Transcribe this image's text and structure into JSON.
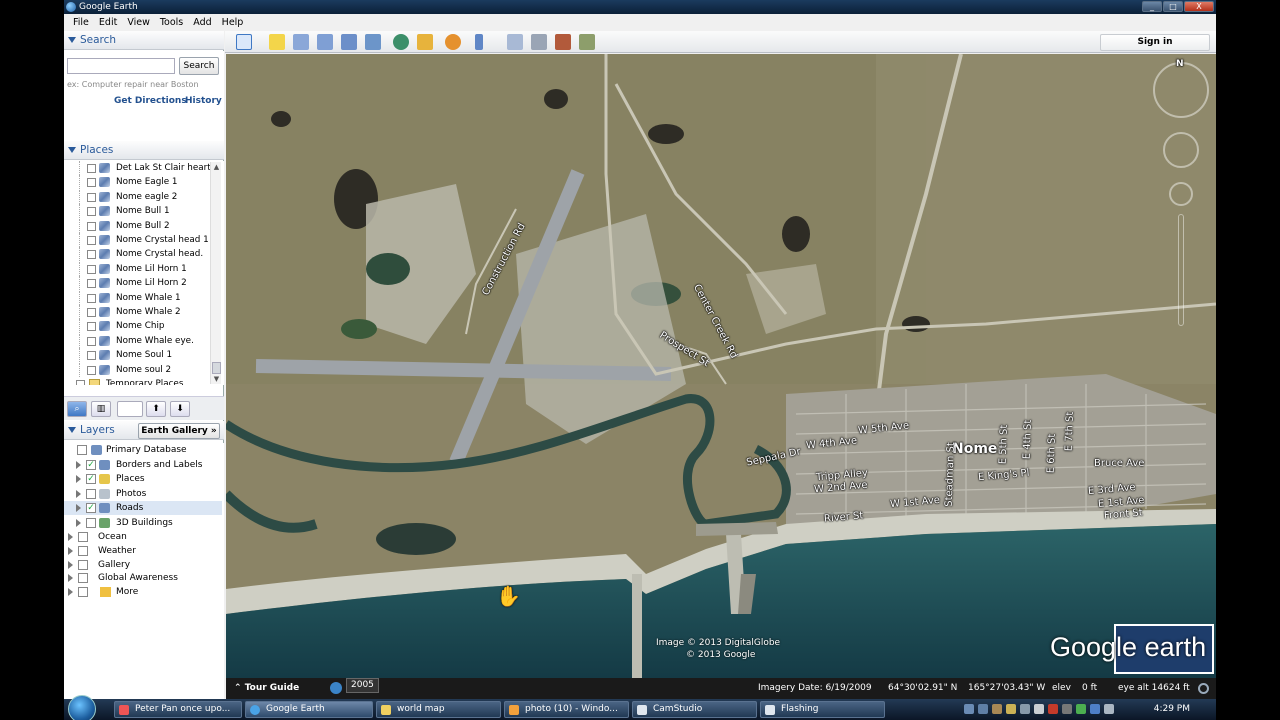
{
  "window": {
    "title": "Google Earth",
    "controls": [
      "_",
      "□",
      "X"
    ]
  },
  "menu": [
    "File",
    "Edit",
    "View",
    "Tools",
    "Add",
    "Help"
  ],
  "search": {
    "header": "Search",
    "button": "Search",
    "input_value": "",
    "hint": "ex: Computer repair near Boston",
    "get_directions": "Get Directions",
    "history": "History"
  },
  "places": {
    "header": "Places",
    "items": [
      "Det Lak St Clair heart.",
      "Nome Eagle 1",
      "Nome eagle 2",
      "Nome Bull 1",
      "Nome Bull 2",
      "Nome Crystal head 1",
      "Nome Crystal head.",
      "Nome Lil  Horn 1",
      "Nome Lil Horn 2",
      "Nome Whale 1",
      "Nome Whale 2",
      "Nome Chip",
      "Nome Whale eye.",
      "Nome Soul 1",
      "Nome soul 2",
      "Temporary Places"
    ],
    "tool_up": "⬆",
    "tool_down": "⬇"
  },
  "layers": {
    "header": "Layers",
    "gallery_button": "Earth Gallery »",
    "items": [
      {
        "label": "Primary Database",
        "checked": ""
      },
      {
        "label": "Borders and Labels",
        "checked": "✓"
      },
      {
        "label": "Places",
        "checked": "✓"
      },
      {
        "label": "Photos",
        "checked": ""
      },
      {
        "label": "Roads",
        "checked": "✓"
      },
      {
        "label": "3D Buildings",
        "checked": ""
      },
      {
        "label": "Ocean",
        "checked": ""
      },
      {
        "label": "Weather",
        "checked": ""
      },
      {
        "label": "Gallery",
        "checked": ""
      },
      {
        "label": "Global Awareness",
        "checked": ""
      },
      {
        "label": "More",
        "checked": ""
      }
    ]
  },
  "toolbar": {
    "sign_in": "Sign in"
  },
  "map": {
    "labels": {
      "construction_rd": "Construction Rd",
      "prospect_st": "Prospect St",
      "center_creek_rd": "Center Creek Rd",
      "nome": "Nome",
      "w_5th_ave": "W 5th Ave",
      "w_4th_ave": "W 4th Ave",
      "seppala_dr": "Seppala Dr",
      "tripp_alley": "Tripp Alley",
      "w_2nd_ave": "W 2nd Ave",
      "w_1st_ave": "W 1st Ave",
      "river_st": "River St",
      "steadman_st": "Steadman St",
      "e_kings_pl": "E King's Pl",
      "e_3rd_ave": "E 3rd Ave",
      "e_1st_ave": "E 1st Ave",
      "front_st": "Front St",
      "bruce_ave": "Bruce Ave",
      "st_e5": "E 5th St",
      "st_e4": "E 4th St",
      "st_e6": "E 6th St",
      "st_e7": "E 7th St"
    },
    "copyright_1": "Image © 2013 DigitalGlobe",
    "copyright_2": "© 2013 Google",
    "logo": "Google earth",
    "compass_n": "N"
  },
  "status": {
    "tour_guide": "Tour Guide",
    "year": "2005",
    "imagery_date": "Imagery Date: 6/19/2009",
    "lat": "64°30'02.91\" N",
    "lon": "165°27'03.43\" W",
    "elev_label": "elev",
    "elev_value": "0 ft",
    "eye_alt": "eye alt  14624 ft"
  },
  "taskbar": {
    "tasks": [
      "Peter Pan once upo...",
      "Google Earth",
      "world map",
      "photo (10) - Windo...",
      "CamStudio",
      "Flashing"
    ],
    "clock": "4:29 PM"
  },
  "colors": {
    "accent": "#2a5a9a",
    "sea": "#1f4f5a",
    "land": "#8c8568"
  }
}
